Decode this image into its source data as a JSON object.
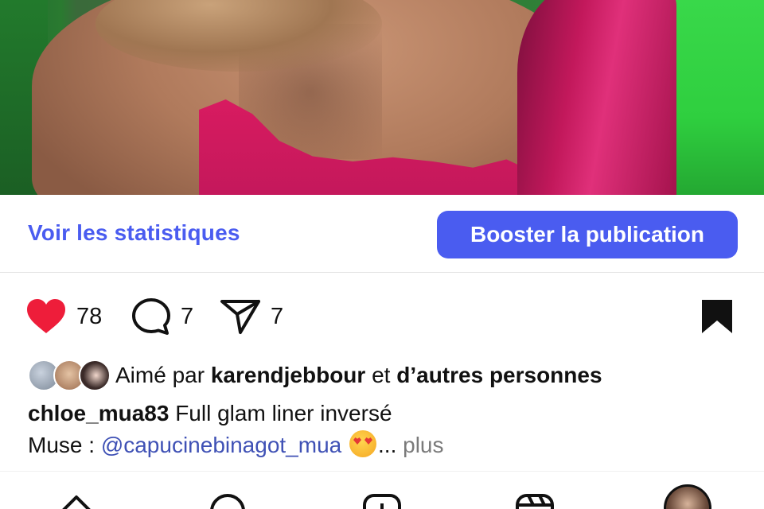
{
  "post": {
    "stats_link": "Voir les statistiques",
    "boost_button": "Booster la publication",
    "likes_count": "78",
    "comments_count": "7",
    "shares_count": "7",
    "liked_by_prefix": "Aimé par",
    "liked_by_user": "karendjebbour",
    "liked_by_and": "et",
    "liked_by_others": "d’autres personnes",
    "caption_user": "chloe_mua83",
    "caption_line1": "Full glam liner inversé",
    "caption_line2_prefix": "Muse :",
    "caption_mention": "@capucinebinagot_mua",
    "caption_more_ellipsis": "...",
    "caption_more": "plus"
  },
  "icons": {
    "like": "heart-filled-icon",
    "comment": "comment-icon",
    "share": "paper-plane-icon",
    "save": "bookmark-filled-icon",
    "emoji": "heart-eyes-emoji",
    "nav": [
      "home-icon",
      "search-icon",
      "create-icon",
      "reels-icon",
      "profile-avatar"
    ]
  },
  "colors": {
    "accent": "#4a5cf0",
    "like": "#ee1d3a",
    "mention": "#3f51b5",
    "muted": "#7a7a7a"
  }
}
